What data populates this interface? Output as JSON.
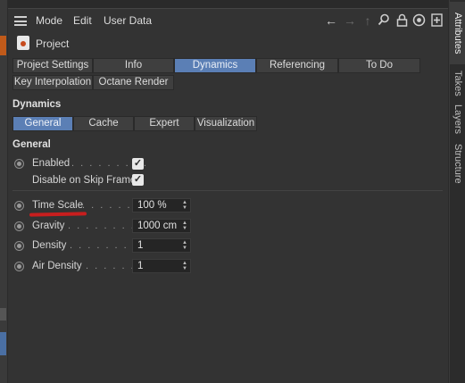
{
  "menubar": {
    "items": [
      "Mode",
      "Edit",
      "User Data"
    ],
    "icons": [
      "back-arrow-icon",
      "forward-arrow-icon",
      "up-arrow-icon",
      "search-icon",
      "lock-icon",
      "settings-icon",
      "new-panel-icon"
    ]
  },
  "project": {
    "label": "Project"
  },
  "tabs_row1": [
    "Project Settings",
    "Info",
    "Dynamics",
    "Referencing",
    "To Do"
  ],
  "tabs_row2": [
    "Key Interpolation",
    "Octane Render"
  ],
  "active_tab": "Dynamics",
  "section_title": "Dynamics",
  "subtabs": [
    "General",
    "Cache",
    "Expert",
    "Visualization"
  ],
  "active_subtab": "General",
  "general_title": "General",
  "params": {
    "enabled": {
      "label": "Enabled",
      "checked": true
    },
    "disable_skip": {
      "label": "Disable on Skip Frame",
      "checked": true
    },
    "time_scale": {
      "label": "Time Scale",
      "value": "100 %"
    },
    "gravity": {
      "label": "Gravity",
      "value": "1000 cm"
    },
    "density": {
      "label": "Density",
      "value": "1"
    },
    "air_density": {
      "label": "Air Density",
      "value": "1"
    }
  },
  "side_tabs": [
    "Attributes",
    "Takes",
    "Layers",
    "Structure"
  ],
  "colors": {
    "accent": "#5b7fb5",
    "annotation": "#c81e1e",
    "panel": "#333333"
  }
}
